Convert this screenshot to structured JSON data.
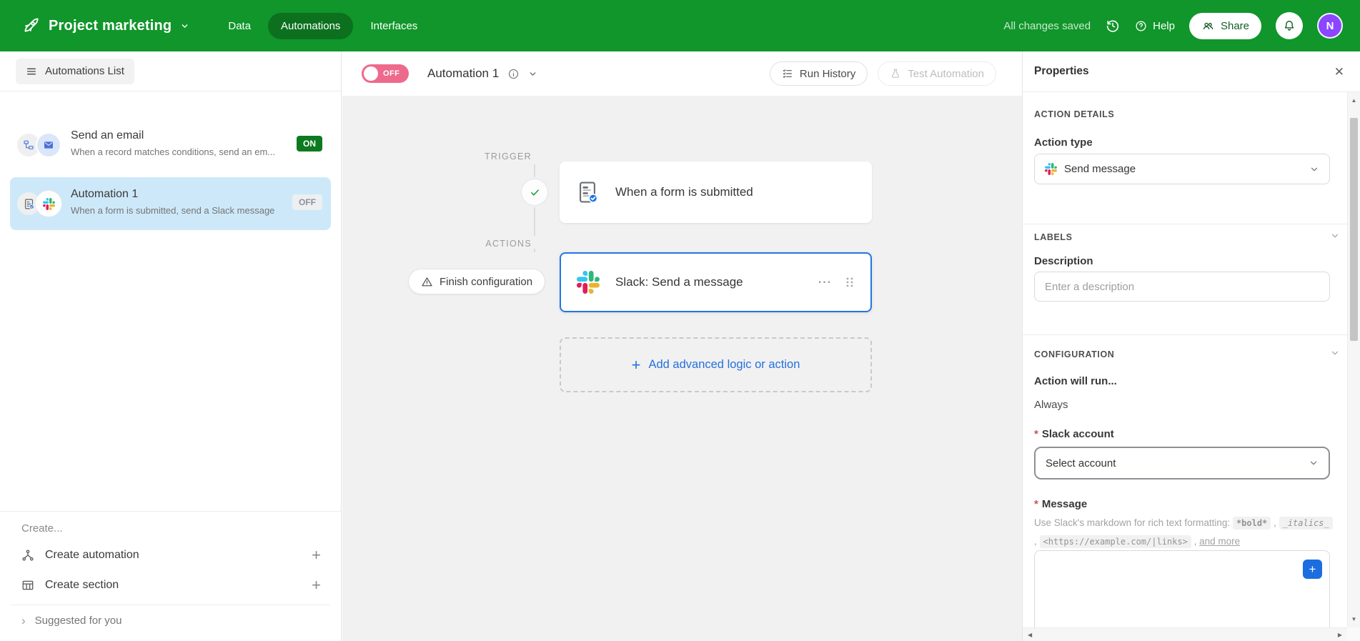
{
  "topbar": {
    "app_name": "Project marketing",
    "tabs": [
      {
        "label": "Data"
      },
      {
        "label": "Automations"
      },
      {
        "label": "Interfaces"
      }
    ],
    "status_text": "All changes saved",
    "help_label": "Help",
    "share_label": "Share",
    "avatar_initial": "N"
  },
  "sidebar": {
    "header_button_label": "Automations List",
    "automations": [
      {
        "title": "Send an email",
        "description": "When a record matches conditions, send an em...",
        "badge": "ON"
      },
      {
        "title": "Automation 1",
        "description": "When a form is submitted, send a Slack message",
        "badge": "OFF"
      }
    ],
    "create_label": "Create...",
    "create_automation_label": "Create automation",
    "create_section_label": "Create section",
    "suggested_label": "Suggested for you"
  },
  "canvas": {
    "toggle_label": "OFF",
    "title": "Automation 1",
    "run_history_label": "Run History",
    "test_automation_label": "Test Automation",
    "trigger_section_label": "TRIGGER",
    "actions_section_label": "ACTIONS",
    "trigger_card_title": "When a form is submitted",
    "finish_configuration_label": "Finish configuration",
    "action_card_title": "Slack: Send a message",
    "add_action_label": "Add advanced logic or action"
  },
  "properties_panel": {
    "title": "Properties",
    "action_details_heading": "ACTION DETAILS",
    "action_type_label": "Action type",
    "action_type_value": "Send message",
    "labels_heading": "LABELS",
    "description_label": "Description",
    "description_placeholder": "Enter a description",
    "configuration_heading": "CONFIGURATION",
    "run_condition_label": "Action will run...",
    "run_condition_value": "Always",
    "required_marker": "*",
    "slack_account_label": "Slack account",
    "slack_account_value": "Select account",
    "message_label": "Message",
    "message_hint_prefix": "Use Slack's markdown for rich text formatting:",
    "message_hint_bold": "*bold*",
    "message_hint_italics": "_italics_",
    "message_hint_link": "<https://example.com/|links>",
    "message_hint_separator": ",",
    "message_hint_more": "and more"
  },
  "icons": {
    "close": "✕",
    "more": "⋯",
    "plus": "+",
    "chevron_right": "›",
    "scroll_up": "▲",
    "scroll_down": "▼",
    "scroll_left": "◀",
    "scroll_right": "▶"
  },
  "colors": {
    "topbar_green": "#10962a",
    "accent_blue": "#2376e5",
    "toggle_off_pink": "#ed6a8c",
    "selected_item_blue": "#cde9f9",
    "on_badge_green": "#0c7a1f",
    "avatar_purple": "#8b46ff"
  }
}
